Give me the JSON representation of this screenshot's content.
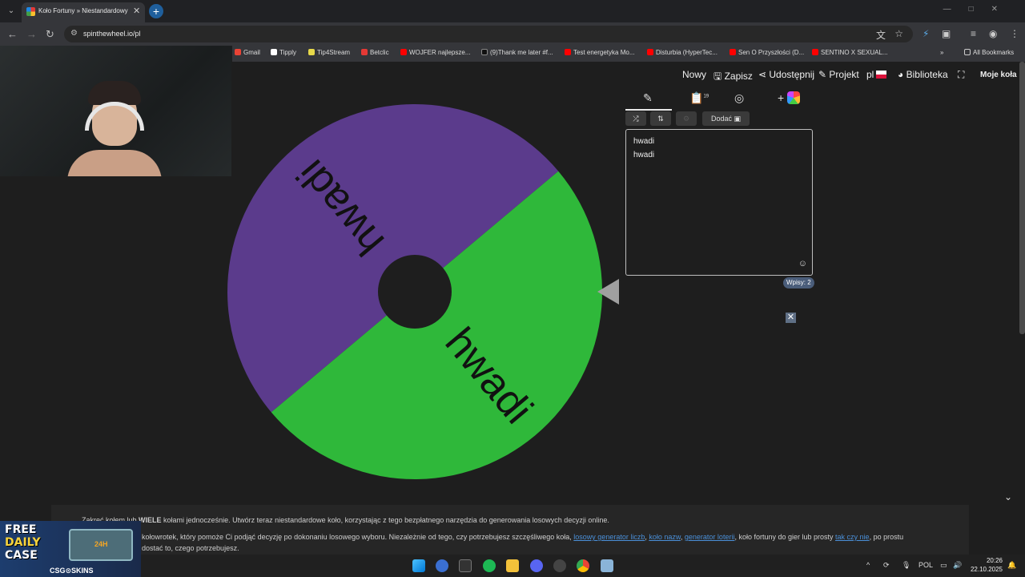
{
  "browser": {
    "tab_title": "Koło Fortuny » Niestandardowy",
    "url": "spinthewheel.io/pl",
    "bookmarks": [
      "Gmail",
      "Tipply",
      "Tip4Stream",
      "Betclic",
      "WOJFER najlepsze...",
      "(9)Thank me later #f...",
      "Test energetyka Mo...",
      "Disturbia (HyperTec...",
      "Sen O Przyszłości (D...",
      "SENTINO X SEXUAL..."
    ],
    "all_bookmarks": "All Bookmarks"
  },
  "header": {
    "items": [
      "Nowy",
      "Zapisz",
      "Udostępnij",
      "Projekt",
      "pl",
      "Biblioteka"
    ],
    "moje_kola": "Moje koła"
  },
  "wheel": {
    "segments": [
      {
        "label": "hwadi",
        "color": "#5b3b8c"
      },
      {
        "label": "hwadi",
        "color": "#2fb83a"
      }
    ],
    "center_color": "#1e1e1e",
    "pointer_color": "#a0a0a0"
  },
  "editor": {
    "badge": "19",
    "add_label": "Dodać",
    "entries": [
      "hwadi",
      "hwadi"
    ],
    "count_label": "Wpisy: 2"
  },
  "description": {
    "line1_a": "Zakręć kołem lub ",
    "line1_b": "WIELE",
    "line1_c": " kołami jednocześnie. Utwórz teraz niestandardowe koło, korzystając z tego bezpłatnego narzędzia do generowania losowych decyzji online.",
    "line2_a": "kołowrotek, który pomoże Ci podjąć decyzję po dokonaniu losowego wyboru. Niezależnie od tego, czy potrzebujesz szczęśliwego koła, ",
    "link1": "losowy generator liczb",
    "link2": "koło nazw",
    "link3": "generator loterii",
    "line2_b": ", koło fortuny do gier lub prosty ",
    "link4": "tak czy nie",
    "line2_c": ", po prostu",
    "line3": "dostać to, czego potrzebujesz."
  },
  "sponsor": {
    "line1": "FREE",
    "line2": "DAILY",
    "line3": "CASE",
    "timer": "24H",
    "brand": "CSG⊙SKINS"
  },
  "taskbar": {
    "lang": "POL",
    "time": "20:26",
    "date": "22.10.2025"
  }
}
